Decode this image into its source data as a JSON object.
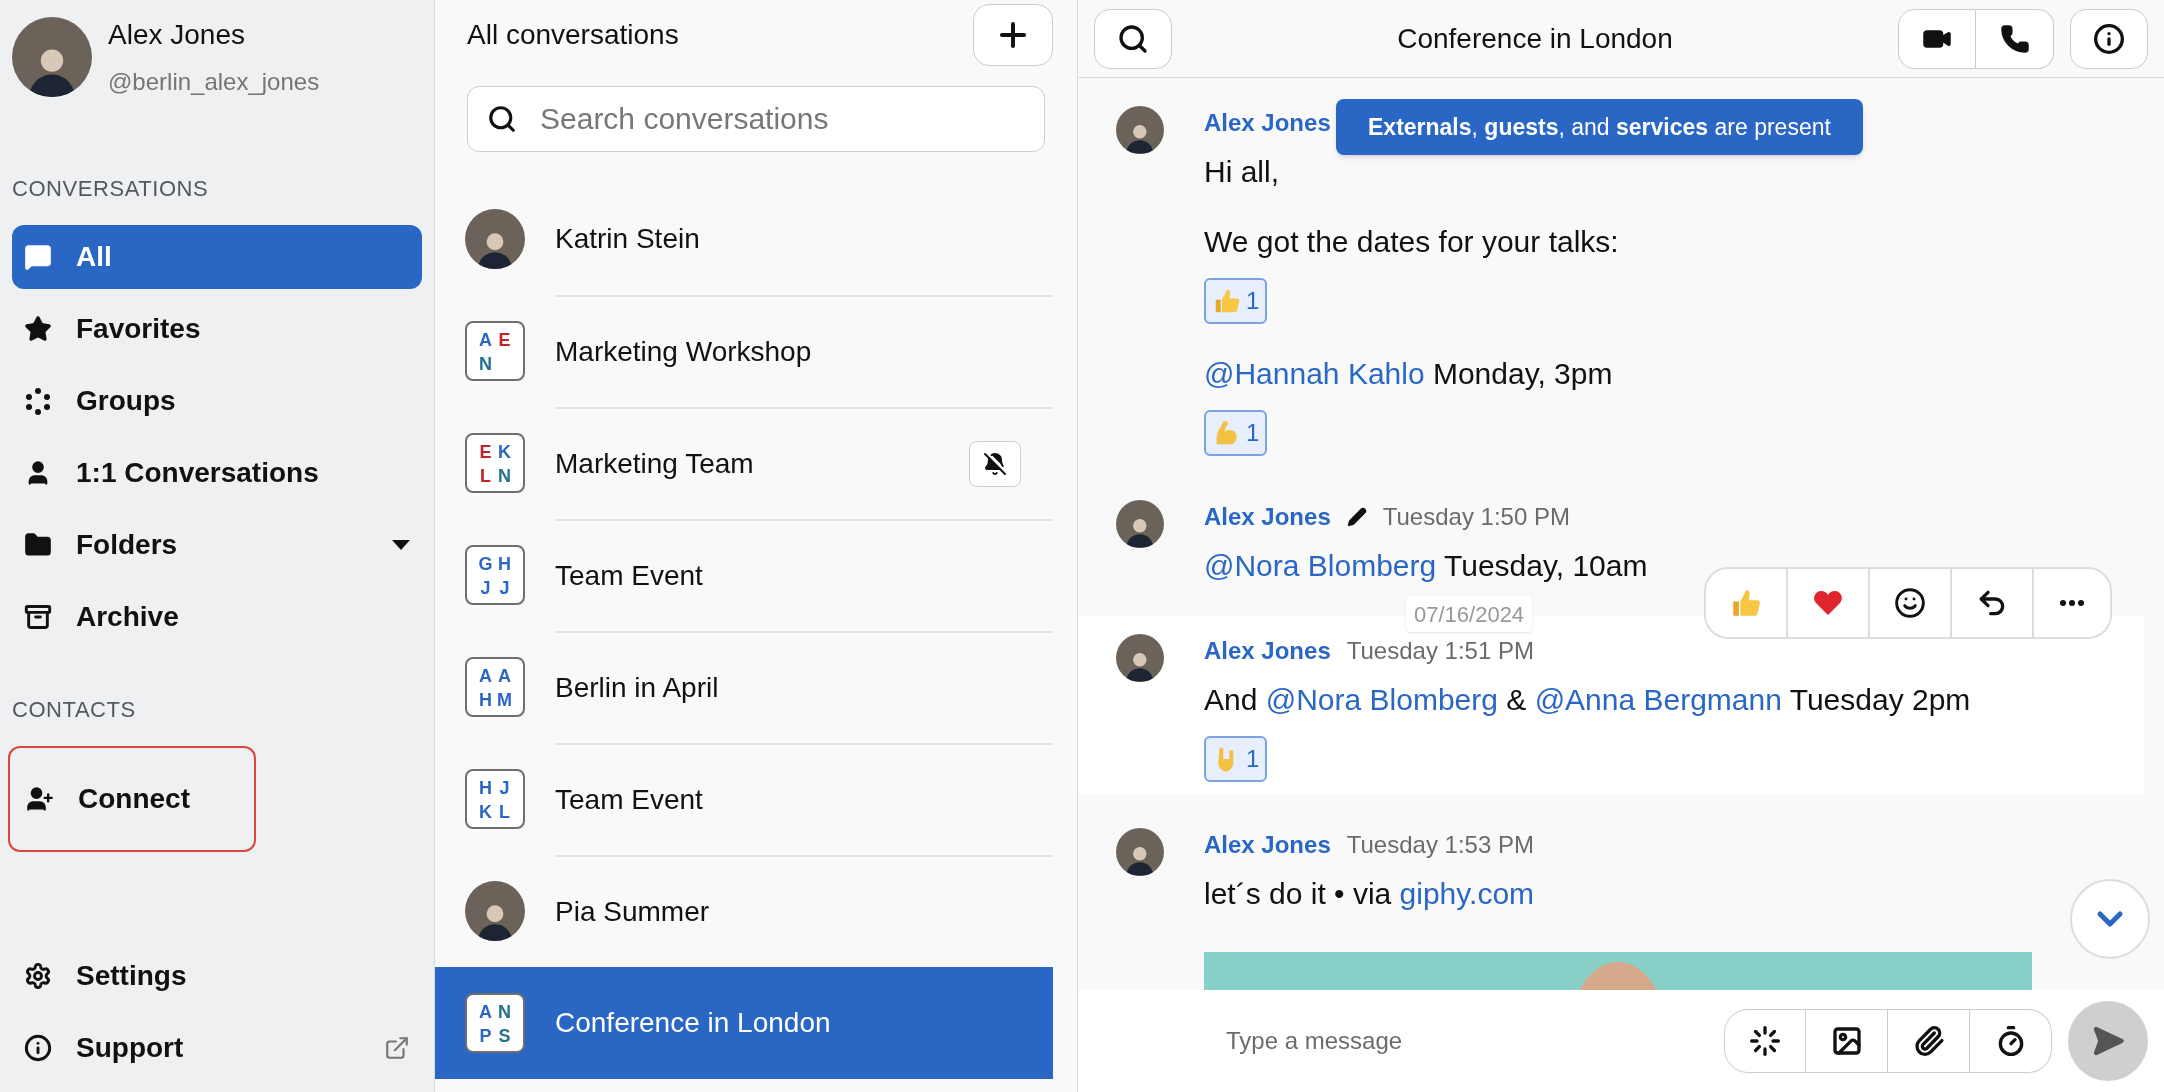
{
  "profile": {
    "name": "Alex Jones",
    "handle": "@berlin_alex_jones"
  },
  "sidebar": {
    "sections": [
      {
        "title": "CONVERSATIONS",
        "items": [
          {
            "label": "All",
            "kind": "nav",
            "selected": true,
            "highlighted": false
          },
          {
            "label": "Favorites",
            "kind": "nav",
            "selected": false,
            "highlighted": false
          },
          {
            "label": "Groups",
            "kind": "nav",
            "selected": false,
            "highlighted": false
          },
          {
            "label": "1:1 Conversations",
            "kind": "nav",
            "selected": false,
            "highlighted": false
          },
          {
            "label": "Folders",
            "kind": "dropdown",
            "selected": false,
            "highlighted": false
          },
          {
            "label": "Archive",
            "kind": "nav",
            "selected": false,
            "highlighted": false
          }
        ]
      },
      {
        "title": "CONTACTS",
        "items": [
          {
            "label": "Connect",
            "kind": "nav",
            "selected": false,
            "highlighted": true
          }
        ]
      }
    ],
    "footer": [
      {
        "label": "Settings",
        "kind": "nav"
      },
      {
        "label": "Support",
        "kind": "external"
      }
    ]
  },
  "conversations": {
    "title": "All conversations",
    "search": {
      "placeholder": "Search conversations"
    },
    "items": [
      {
        "name": "Katrin Stein",
        "kind": "person",
        "muted": false,
        "selected": false
      },
      {
        "name": "Marketing Workshop",
        "kind": "group",
        "muted": false,
        "selected": false,
        "initials": [
          {
            "letter": "A",
            "color": "#2a67c4"
          },
          {
            "letter": "E",
            "color": "#c0232a"
          },
          {
            "letter": "N",
            "color": "#24708f"
          }
        ]
      },
      {
        "name": "Marketing Team",
        "kind": "group",
        "muted": true,
        "selected": false,
        "initials": [
          {
            "letter": "E",
            "color": "#c0232a"
          },
          {
            "letter": "K",
            "color": "#2a67c4"
          },
          {
            "letter": "L",
            "color": "#c0232a"
          },
          {
            "letter": "N",
            "color": "#24708f"
          }
        ]
      },
      {
        "name": "Team Event",
        "kind": "group",
        "muted": false,
        "selected": false,
        "initials": [
          {
            "letter": "G",
            "color": "#2a67c4"
          },
          {
            "letter": "H",
            "color": "#2a67c4"
          },
          {
            "letter": "J",
            "color": "#2a67c4"
          },
          {
            "letter": "J",
            "color": "#2a67c4"
          }
        ]
      },
      {
        "name": "Berlin in April",
        "kind": "group",
        "muted": false,
        "selected": false,
        "initials": [
          {
            "letter": "A",
            "color": "#2a67c4"
          },
          {
            "letter": "A",
            "color": "#2a67c4"
          },
          {
            "letter": "H",
            "color": "#2a67c4"
          },
          {
            "letter": "M",
            "color": "#2a67c4"
          }
        ]
      },
      {
        "name": "Team Event",
        "kind": "group",
        "muted": false,
        "selected": false,
        "initials": [
          {
            "letter": "H",
            "color": "#2a67c4"
          },
          {
            "letter": "J",
            "color": "#2a67c4"
          },
          {
            "letter": "K",
            "color": "#2a67c4"
          },
          {
            "letter": "L",
            "color": "#2a67c4"
          }
        ]
      },
      {
        "name": "Pia Summer",
        "kind": "person",
        "muted": false,
        "selected": false
      },
      {
        "name": "Conference in London",
        "kind": "group",
        "muted": false,
        "selected": true,
        "initials": [
          {
            "letter": "A",
            "color": "#2a67c4"
          },
          {
            "letter": "N",
            "color": "#24708f"
          },
          {
            "letter": "P",
            "color": "#2a67c4"
          },
          {
            "letter": "S",
            "color": "#24708f"
          }
        ]
      }
    ]
  },
  "chat": {
    "title": "Conference in London",
    "banner": "**Externals**, **guests**, and **services** are present",
    "date_chip": "07/16/2024",
    "composer": {
      "placeholder": "Type a message"
    },
    "messages": [
      {
        "author": "Alex Jones",
        "edited": false,
        "hovered": false,
        "blocks": [
          {
            "kind": "text",
            "parts": [
              {
                "kind": "plain",
                "text": "Hi all,"
              }
            ]
          },
          {
            "kind": "text",
            "parts": [
              {
                "kind": "plain",
                "text": "We got the dates for your talks:"
              }
            ]
          },
          {
            "kind": "reaction",
            "count": "1"
          },
          {
            "kind": "text",
            "parts": [
              {
                "kind": "mention",
                "text": "@Hannah Kahlo"
              },
              {
                "kind": "plain",
                "text": " Monday, 3pm"
              }
            ]
          },
          {
            "kind": "reaction",
            "count": "1"
          }
        ]
      },
      {
        "author": "Alex Jones",
        "edited": true,
        "time": "Tuesday 1:50 PM",
        "hovered": false,
        "blocks": [
          {
            "kind": "text",
            "parts": [
              {
                "kind": "mention",
                "text": "@Nora Blomberg"
              },
              {
                "kind": "plain",
                "text": " Tuesday, 10am"
              }
            ]
          }
        ]
      },
      {
        "author": "Alex Jones",
        "edited": false,
        "time": "Tuesday 1:51 PM",
        "hovered": true,
        "blocks": [
          {
            "kind": "text",
            "parts": [
              {
                "kind": "plain",
                "text": "And "
              },
              {
                "kind": "mention",
                "text": "@Nora Blomberg"
              },
              {
                "kind": "plain",
                "text": " & "
              },
              {
                "kind": "mention",
                "text": "@Anna Bergmann"
              },
              {
                "kind": "plain",
                "text": " Tuesday 2pm"
              }
            ]
          },
          {
            "kind": "reaction",
            "count": "1"
          }
        ]
      },
      {
        "author": "Alex Jones",
        "edited": false,
        "time": "Tuesday 1:53 PM",
        "hovered": false,
        "blocks": [
          {
            "kind": "text",
            "parts": [
              {
                "kind": "plain",
                "text": "let´s do it • via "
              },
              {
                "kind": "link",
                "text": "giphy.com"
              }
            ]
          },
          {
            "kind": "gif"
          }
        ]
      }
    ]
  }
}
